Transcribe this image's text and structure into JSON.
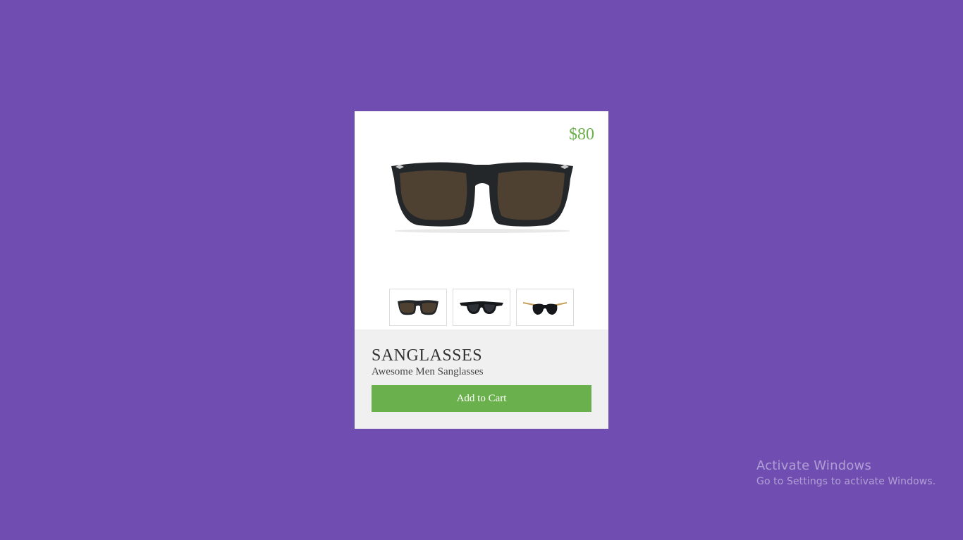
{
  "product": {
    "price": "$80",
    "title": "SANGLASSES",
    "subtitle": "Awesome Men Sanglasses",
    "add_to_cart_label": "Add to Cart",
    "accent_color": "#6ab04c",
    "background_color": "#704eb1",
    "thumbnails": [
      {
        "name": "brown-lens-sunglasses"
      },
      {
        "name": "black-rectangular-sunglasses"
      },
      {
        "name": "black-gold-temple-sunglasses"
      }
    ]
  },
  "watermark": {
    "title": "Activate Windows",
    "subtitle": "Go to Settings to activate Windows."
  }
}
